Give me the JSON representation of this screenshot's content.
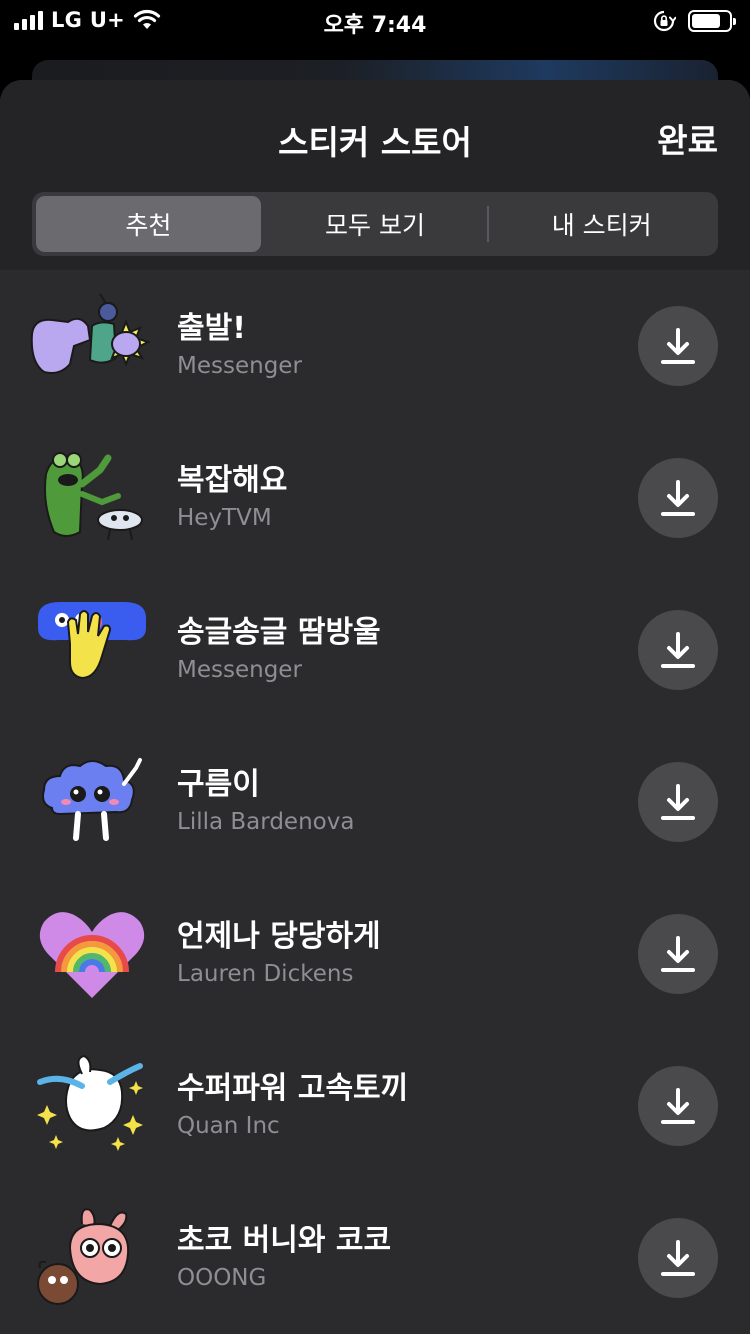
{
  "status_bar": {
    "carrier": "LG U+",
    "time": "오후 7:44",
    "icons": [
      "signal-icon",
      "wifi-icon",
      "rotation-lock-icon",
      "battery-icon"
    ]
  },
  "sheet": {
    "title": "스티커 스토어",
    "done_label": "완료"
  },
  "tabs": [
    {
      "label": "추천",
      "active": true
    },
    {
      "label": "모두 보기",
      "active": false
    },
    {
      "label": "내 스티커",
      "active": false
    }
  ],
  "packs": [
    {
      "name": "출발!",
      "author": "Messenger",
      "icon": "flexing-arm-sticker-icon"
    },
    {
      "name": "복잡해요",
      "author": "HeyTVM",
      "icon": "cactus-sticker-icon"
    },
    {
      "name": "송글송글 땀방울",
      "author": "Messenger",
      "icon": "sweat-drop-hand-sticker-icon"
    },
    {
      "name": "구름이",
      "author": "Lilla Bardenova",
      "icon": "cloud-character-sticker-icon"
    },
    {
      "name": "언제나 당당하게",
      "author": "Lauren Dickens",
      "icon": "rainbow-heart-sticker-icon"
    },
    {
      "name": "수퍼파워 고속토끼",
      "author": "Quan Inc",
      "icon": "sparkle-bunny-sticker-icon"
    },
    {
      "name": "초코 버니와 코코",
      "author": "OOONG",
      "icon": "choco-bunny-sticker-icon"
    }
  ],
  "colors": {
    "sheet_bg": "#2b2b2d",
    "header_bg": "#242426",
    "segment_bg": "#3a3a3c",
    "segment_active": "#6b6b6f",
    "download_button": "#4a4a4d",
    "secondary_text": "#8e8e93"
  }
}
